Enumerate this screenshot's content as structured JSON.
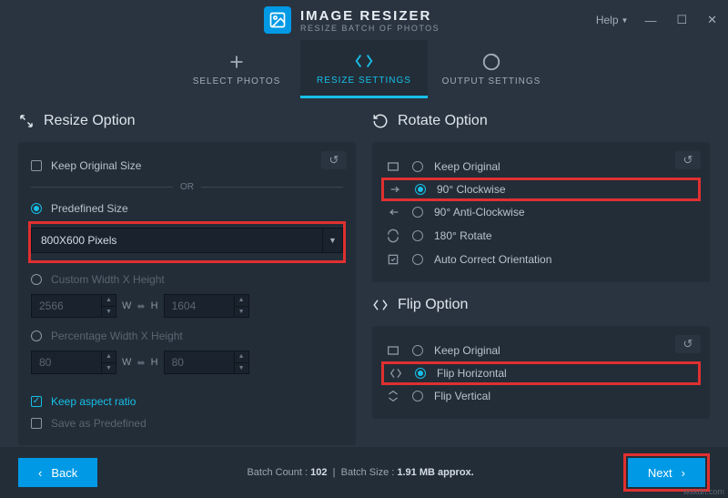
{
  "app": {
    "title": "IMAGE RESIZER",
    "subtitle": "RESIZE BATCH OF PHOTOS"
  },
  "help": "Help",
  "tabs": {
    "select": "SELECT PHOTOS",
    "resize": "RESIZE SETTINGS",
    "output": "OUTPUT SETTINGS"
  },
  "resize": {
    "heading": "Resize Option",
    "keep_orig": "Keep Original Size",
    "or": "OR",
    "predefined": "Predefined Size",
    "size_value": "800X600 Pixels",
    "custom": "Custom Width X Height",
    "w": "2566",
    "h": "1604",
    "wl": "W",
    "hl": "H",
    "percent": "Percentage Width X Height",
    "pw": "80",
    "ph": "80",
    "aspect": "Keep aspect ratio",
    "save_pre": "Save as Predefined"
  },
  "rotate": {
    "heading": "Rotate Option",
    "keep": "Keep Original",
    "cw": "90° Clockwise",
    "acw": "90° Anti-Clockwise",
    "r180": "180° Rotate",
    "auto": "Auto Correct Orientation"
  },
  "flip": {
    "heading": "Flip Option",
    "keep": "Keep Original",
    "h": "Flip Horizontal",
    "v": "Flip Vertical"
  },
  "footer": {
    "back": "Back",
    "next": "Next",
    "count_lbl": "Batch Count :",
    "count": "102",
    "size_lbl": "Batch Size :",
    "size": "1.91 MB approx."
  },
  "watermark": "wsxdn.com"
}
